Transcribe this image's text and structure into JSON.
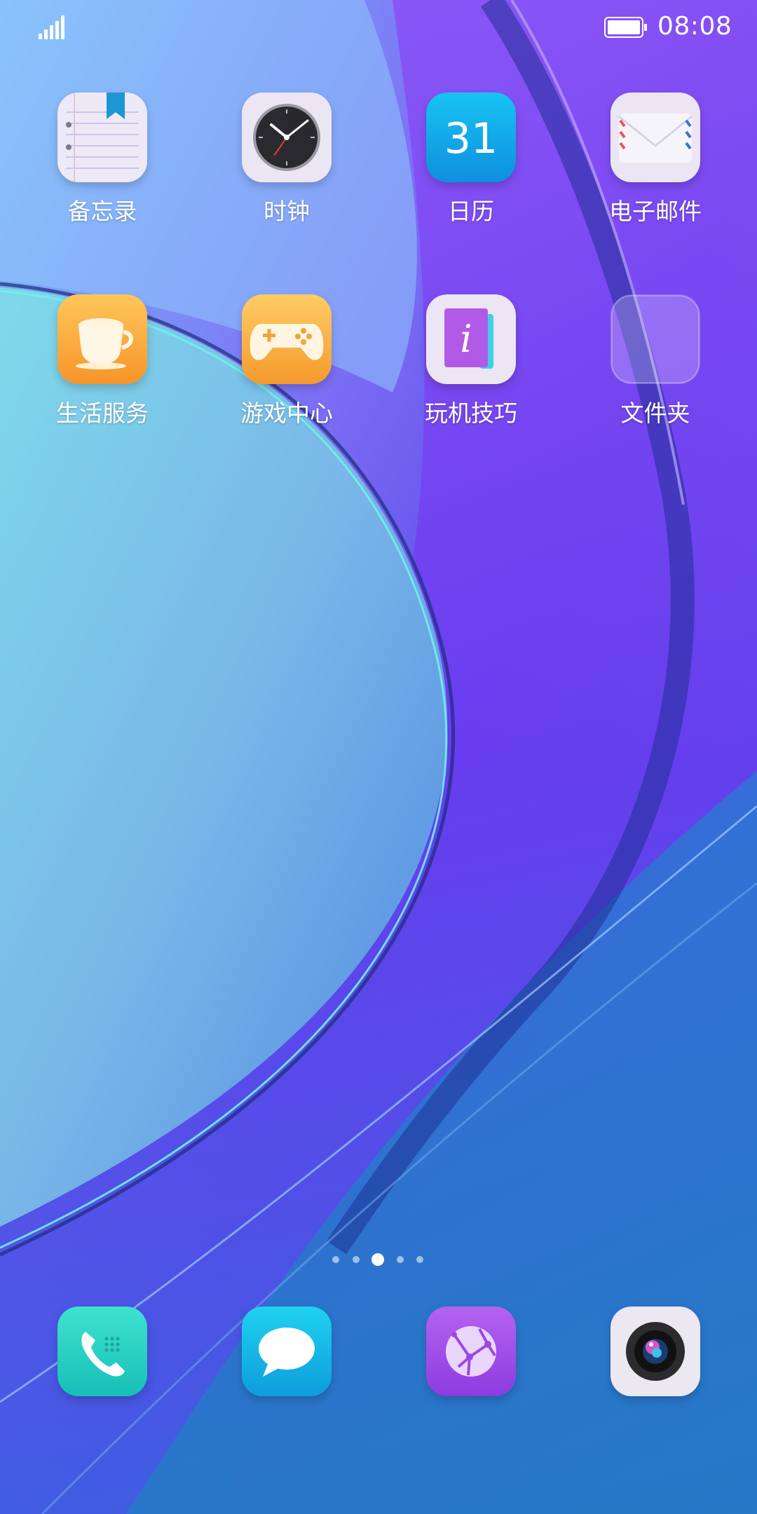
{
  "status_bar": {
    "time": "08:08"
  },
  "home": {
    "apps": [
      {
        "label": "备忘录",
        "icon": "notes-icon"
      },
      {
        "label": "时钟",
        "icon": "clock-icon"
      },
      {
        "label": "日历",
        "icon": "calendar-icon",
        "icon_text": "31"
      },
      {
        "label": "电子邮件",
        "icon": "email-icon"
      },
      {
        "label": "生活服务",
        "icon": "coffee-cup-icon"
      },
      {
        "label": "游戏中心",
        "icon": "gamepad-icon"
      },
      {
        "label": "玩机技巧",
        "icon": "info-book-icon",
        "icon_text": "i"
      },
      {
        "label": "文件夹",
        "icon": "folder-icon"
      }
    ]
  },
  "pager": {
    "count": 5,
    "active_index": 2
  },
  "dock": {
    "apps": [
      {
        "icon": "phone-icon"
      },
      {
        "icon": "message-icon"
      },
      {
        "icon": "browser-globe-icon"
      },
      {
        "icon": "camera-icon"
      }
    ]
  },
  "colors": {
    "wallpaper_top": "#7ab8f8",
    "wallpaper_purple": "#6a35f2",
    "wallpaper_bottom": "#2a78cf",
    "teal_accent": "#5fd8d6"
  }
}
